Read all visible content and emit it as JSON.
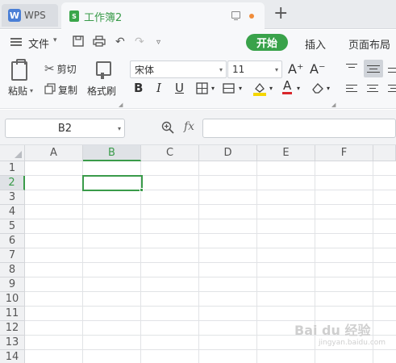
{
  "title_bar": {
    "app_tab": "WPS",
    "doc_tab": "工作簿2",
    "new_tab_symbol": "+"
  },
  "menu": {
    "file": "文件",
    "tabs": [
      "开始",
      "插入",
      "页面布局"
    ]
  },
  "ribbon": {
    "paste": "粘贴",
    "cut": "剪切",
    "copy": "复制",
    "format_painter": "格式刷",
    "font_name": "宋体",
    "font_size": "11",
    "increase_font": "A⁺",
    "decrease_font": "A⁻",
    "bold": "B",
    "italic": "I",
    "underline": "U",
    "font_color_glyph": "A"
  },
  "formula_bar": {
    "name_box": "B2",
    "fx": "fx",
    "formula": ""
  },
  "sheet": {
    "columns": [
      "A",
      "B",
      "C",
      "D",
      "E",
      "F"
    ],
    "rows": [
      "1",
      "2",
      "3",
      "4",
      "5",
      "6",
      "7",
      "8",
      "9",
      "10",
      "11",
      "12",
      "13",
      "14"
    ],
    "active_cell": "B2"
  },
  "watermark": {
    "brand": "Bai du 经验",
    "url": "jingyan.baidu.com"
  }
}
